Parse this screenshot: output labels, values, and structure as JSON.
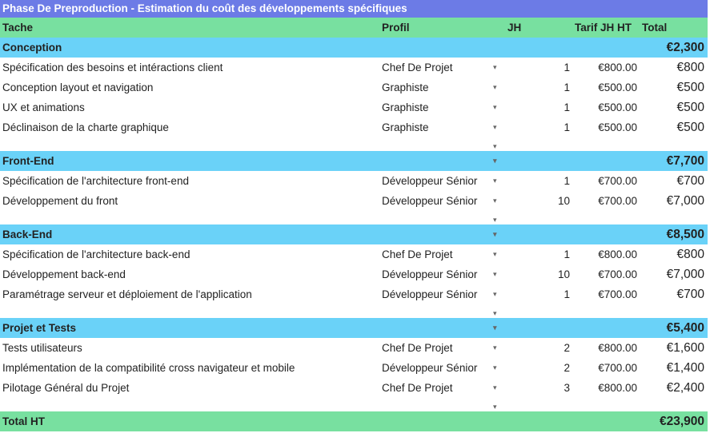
{
  "title": "Phase De Preproduction - Estimation du coût des développements spécifiques",
  "headers": {
    "tache": "Tache",
    "profil": "Profil",
    "jh": "JH",
    "tarif": "Tarif JH HT",
    "total": "Total"
  },
  "arrow_glyph": "▾",
  "sections": [
    {
      "name": "Conception",
      "total": "€2,300",
      "rows": [
        {
          "task": "Spécification des besoins et intéractions client",
          "profil": "Chef De Projet",
          "jh": "1",
          "tarif": "€800.00",
          "total": "€800"
        },
        {
          "task": "Conception layout et navigation",
          "profil": "Graphiste",
          "jh": "1",
          "tarif": "€500.00",
          "total": "€500"
        },
        {
          "task": "UX et animations",
          "profil": "Graphiste",
          "jh": "1",
          "tarif": "€500.00",
          "total": "€500"
        },
        {
          "task": "Déclinaison de la charte graphique",
          "profil": "Graphiste",
          "jh": "1",
          "tarif": "€500.00",
          "total": "€500"
        }
      ]
    },
    {
      "name": "Front-End",
      "total": "€7,700",
      "rows": [
        {
          "task": "Spécification de l'architecture front-end",
          "profil": "Développeur Sénior",
          "jh": "1",
          "tarif": "€700.00",
          "total": "€700"
        },
        {
          "task": "Développement du front",
          "profil": "Développeur Sénior",
          "jh": "10",
          "tarif": "€700.00",
          "total": "€7,000"
        }
      ]
    },
    {
      "name": "Back-End",
      "total": "€8,500",
      "rows": [
        {
          "task": "Spécification de l'architecture back-end",
          "profil": "Chef De Projet",
          "jh": "1",
          "tarif": "€800.00",
          "total": "€800"
        },
        {
          "task": "Développement back-end",
          "profil": "Développeur Sénior",
          "jh": "10",
          "tarif": "€700.00",
          "total": "€7,000"
        },
        {
          "task": "Paramétrage serveur et déploiement de l'application",
          "profil": "Développeur Sénior",
          "jh": "1",
          "tarif": "€700.00",
          "total": "€700"
        }
      ]
    },
    {
      "name": "Projet et Tests",
      "total": "€5,400",
      "rows": [
        {
          "task": "Tests utilisateurs",
          "profil": "Chef De Projet",
          "jh": "2",
          "tarif": "€800.00",
          "total": "€1,600"
        },
        {
          "task": "Implémentation de la compatibilité cross navigateur et mobile",
          "profil": "Développeur Sénior",
          "jh": "2",
          "tarif": "€700.00",
          "total": "€1,400"
        },
        {
          "task": "Pilotage Général du Projet",
          "profil": "Chef De Projet",
          "jh": "3",
          "tarif": "€800.00",
          "total": "€2,400"
        }
      ]
    }
  ],
  "grand_total": {
    "label": "Total HT",
    "value": "€23,900"
  },
  "colors": {
    "title_bg": "#6c7be6",
    "header_bg": "#78e0a0",
    "section_bg": "#6ad2f8"
  }
}
